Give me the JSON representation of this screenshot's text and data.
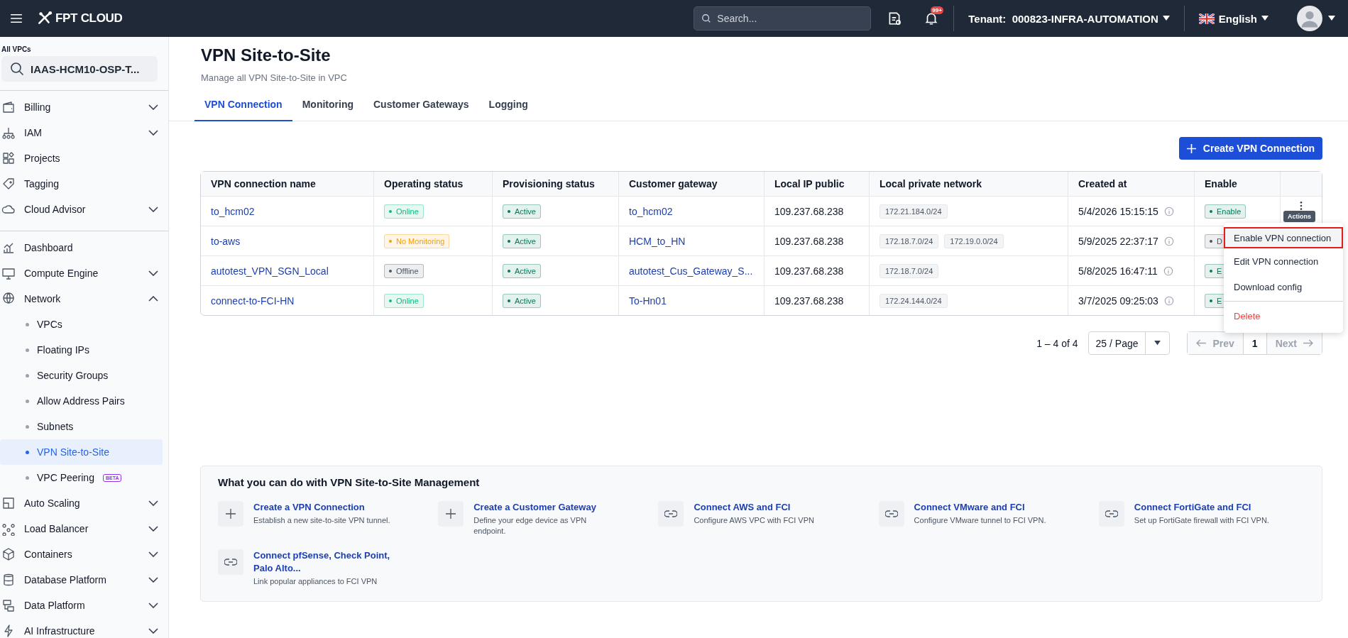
{
  "topbar": {
    "logo": "FPT CLOUD",
    "search": {
      "placeholder": "Search..."
    },
    "notification_badge": "99+",
    "tenant_label": "Tenant:",
    "tenant": "000823-INFRA-AUTOMATION",
    "language": "English"
  },
  "sidebar": {
    "scope_label": "All VPCs",
    "vpc": "IAAS-HCM10-OSP-T...",
    "groups": [
      [
        {
          "label": "Billing",
          "expanded": false
        },
        {
          "label": "IAM",
          "expanded": false
        },
        {
          "label": "Projects"
        },
        {
          "label": "Tagging"
        },
        {
          "label": "Cloud Advisor",
          "expanded": false
        }
      ],
      [
        {
          "label": "Dashboard"
        },
        {
          "label": "Compute Engine",
          "expanded": false
        },
        {
          "label": "Network",
          "expanded": true,
          "children": [
            {
              "label": "VPCs",
              "selected": false
            },
            {
              "label": "Floating IPs",
              "selected": false
            },
            {
              "label": "Security Groups",
              "selected": false
            },
            {
              "label": "Allow Address Pairs",
              "selected": false
            },
            {
              "label": "Subnets",
              "selected": false
            },
            {
              "label": "VPN Site-to-Site",
              "selected": true
            },
            {
              "label": "VPC Peering",
              "selected": false,
              "badge": "BETA"
            }
          ]
        },
        {
          "label": "Auto Scaling",
          "expanded": false
        },
        {
          "label": "Load Balancer",
          "expanded": false
        },
        {
          "label": "Containers",
          "expanded": false
        },
        {
          "label": "Database Platform",
          "expanded": false
        },
        {
          "label": "Data Platform",
          "expanded": false
        },
        {
          "label": "AI Infrastructure",
          "expanded": false
        }
      ]
    ]
  },
  "page": {
    "title": "VPN Site-to-Site",
    "subtitle": "Manage all VPN Site-to-Site in VPC"
  },
  "tabs": [
    {
      "label": "VPN Connection",
      "selected": true
    },
    {
      "label": "Monitoring",
      "selected": false
    },
    {
      "label": "Customer Gateways",
      "selected": false
    },
    {
      "label": "Logging",
      "selected": false
    }
  ],
  "create_button": "Create VPN Connection",
  "table": {
    "columns": [
      "VPN connection name",
      "Operating status",
      "Provisioning status",
      "Customer gateway",
      "Local IP public",
      "Local private network",
      "Created at",
      "Enable"
    ],
    "rows": [
      {
        "name": "to_hcm02",
        "operating": {
          "text": "Online",
          "color": "#10b981"
        },
        "provisioning": {
          "text": "Active",
          "color": "#047857"
        },
        "gateway": "to_hcm02",
        "ip": "109.237.68.238",
        "networks": [
          "172.21.184.0/24"
        ],
        "created": "5/4/2026 15:15:15",
        "enable": {
          "text": "Enable",
          "color": "#047857"
        }
      },
      {
        "name": "to-aws",
        "operating": {
          "text": "No Monitoring",
          "color": "#f59e0b"
        },
        "provisioning": {
          "text": "Active",
          "color": "#047857"
        },
        "gateway": "HCM_to_HN",
        "ip": "109.237.68.238",
        "networks": [
          "172.18.7.0/24",
          "172.19.0.0/24"
        ],
        "created": "5/9/2025 22:37:17",
        "enable": {
          "text": "D",
          "color": "#4b5563"
        }
      },
      {
        "name": "autotest_VPN_SGN_Local",
        "operating": {
          "text": "Offline",
          "color": "#4b5563"
        },
        "provisioning": {
          "text": "Active",
          "color": "#047857"
        },
        "gateway": "autotest_Cus_Gateway_S...",
        "ip": "109.237.68.238",
        "networks": [
          "172.18.7.0/24"
        ],
        "created": "5/8/2025 16:47:11",
        "enable": {
          "text": "E",
          "color": "#047857"
        }
      },
      {
        "name": "connect-to-FCI-HN",
        "operating": {
          "text": "Online",
          "color": "#10b981"
        },
        "provisioning": {
          "text": "Active",
          "color": "#047857"
        },
        "gateway": "To-Hn01",
        "ip": "109.237.68.238",
        "networks": [
          "172.24.144.0/24"
        ],
        "created": "3/7/2025 09:25:03",
        "enable": {
          "text": "E",
          "color": "#047857"
        }
      }
    ]
  },
  "actions_tooltip": "Actions",
  "actions_menu": [
    {
      "label": "Enable VPN connection",
      "selected": true,
      "kind": "normal"
    },
    {
      "label": "Edit VPN connection",
      "selected": false,
      "kind": "normal"
    },
    {
      "label": "Download config",
      "selected": false,
      "kind": "normal"
    },
    {
      "label": "Delete",
      "selected": false,
      "kind": "danger"
    }
  ],
  "pagination": {
    "range": "1 – 4 of 4",
    "page_size": "25 / Page",
    "prev": "Prev",
    "page": "1",
    "next": "Next",
    "prev_disabled": true,
    "next_disabled": true
  },
  "guide": {
    "title": "What you can do with VPN Site-to-Site Management",
    "items": [
      {
        "kind": "plus",
        "title": "Create a VPN Connection",
        "description": "Establish a new site-to-site VPN tunnel."
      },
      {
        "kind": "plus",
        "title": "Create a Customer Gateway",
        "description": "Define your edge device as VPN endpoint."
      },
      {
        "kind": "link",
        "title": "Connect AWS and FCI",
        "description": "Configure AWS VPC with FCI VPN"
      },
      {
        "kind": "link",
        "title": "Connect VMware and FCI",
        "description": "Configure VMware tunnel to FCI VPN."
      },
      {
        "kind": "link",
        "title": "Connect FortiGate and FCI",
        "description": "Set up FortiGate firewall with FCI VPN."
      },
      {
        "kind": "link",
        "title": "Connect pfSense, Check Point, Palo Alto...",
        "description": "Link popular appliances to FCI VPN"
      }
    ]
  }
}
